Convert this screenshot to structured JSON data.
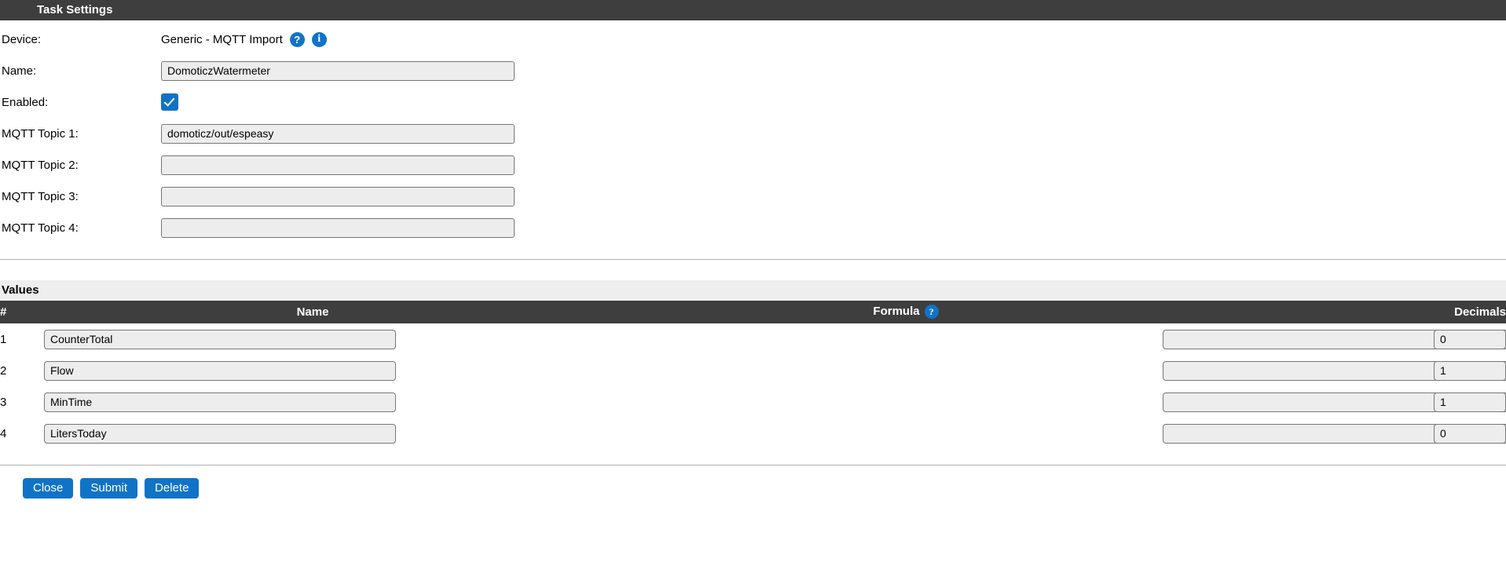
{
  "task_settings": {
    "header": "Task Settings",
    "fields": {
      "device_label": "Device:",
      "device_value": "Generic - MQTT Import",
      "device_help_icon": "?",
      "device_info_icon": "i",
      "name_label": "Name:",
      "name_value": "DomoticzWatermeter",
      "name_placeholder": "",
      "enabled_label": "Enabled:",
      "enabled_checked": true,
      "topic1_label": "MQTT Topic 1:",
      "topic1_value": "domoticz/out/espeasy",
      "topic2_label": "MQTT Topic 2:",
      "topic2_value": "",
      "topic3_label": "MQTT Topic 3:",
      "topic3_value": "",
      "topic4_label": "MQTT Topic 4:",
      "topic4_value": ""
    }
  },
  "values": {
    "title": "Values",
    "columns": {
      "num": "#",
      "name": "Name",
      "formula": "Formula",
      "formula_help_icon": "?",
      "decimals": "Decimals"
    },
    "rows": [
      {
        "num": "1",
        "name": "CounterTotal",
        "formula": "",
        "decimals": "0"
      },
      {
        "num": "2",
        "name": "Flow",
        "formula": "",
        "decimals": "1"
      },
      {
        "num": "3",
        "name": "MinTime",
        "formula": "",
        "decimals": "1"
      },
      {
        "num": "4",
        "name": "LitersToday",
        "formula": "",
        "decimals": "0"
      }
    ]
  },
  "buttons": {
    "close": "Close",
    "submit": "Submit",
    "delete": "Delete"
  },
  "colors": {
    "header_bar": "#3e3e3e",
    "accent_blue": "#1173c6",
    "input_bg": "#ededed",
    "values_title_bg": "#eeeeee"
  }
}
